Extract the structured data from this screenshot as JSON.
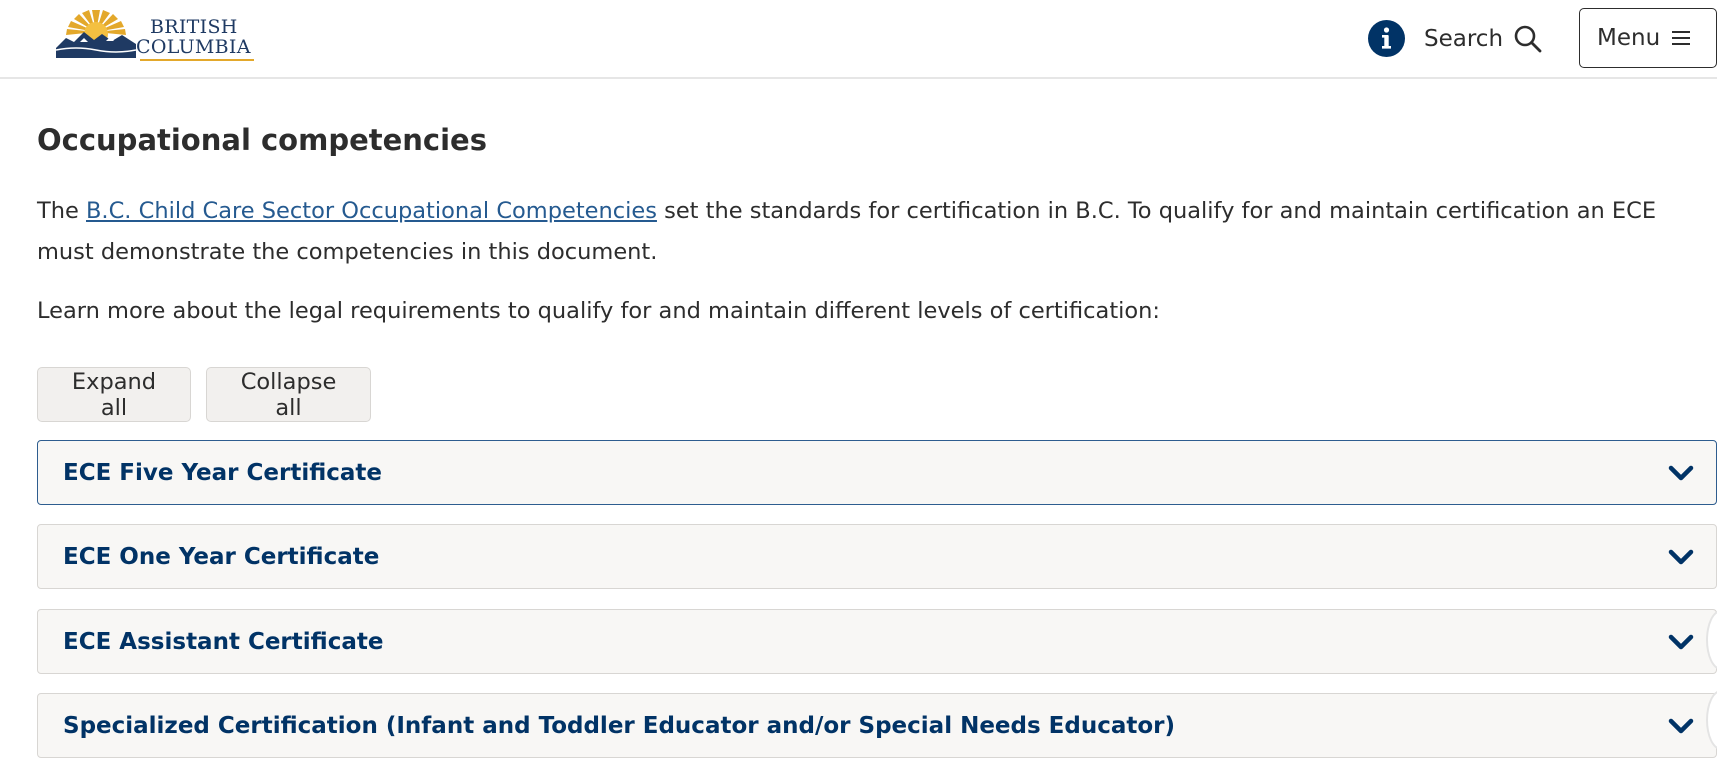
{
  "header": {
    "logo": {
      "line1": "BRITISH",
      "line2": "COLUMBIA",
      "colors": {
        "sun": "#e3a82b",
        "mountains": "#1f3a63"
      }
    },
    "info_icon": "info-icon",
    "search": {
      "label": "Search",
      "icon": "search-icon"
    },
    "menu": {
      "label": "Menu",
      "icon": "hamburger-icon"
    }
  },
  "main": {
    "title": "Occupational competencies",
    "intro": {
      "before_link": "The ",
      "link_text": "B.C. Child Care Sector Occupational Competencies",
      "after_link": " set the standards for certification in B.C. To qualify for and maintain certification an ECE must demonstrate the competencies in this document."
    },
    "learn_more": "Learn more about the legal requirements to qualify for and maintain different levels of certification:",
    "buttons": {
      "expand_all": "Expand all",
      "collapse_all": "Collapse all"
    },
    "accordions": [
      {
        "title": "ECE Five Year Certificate",
        "expanded": false,
        "focused": true
      },
      {
        "title": "ECE One Year Certificate",
        "expanded": false
      },
      {
        "title": "ECE Assistant Certificate",
        "expanded": false
      },
      {
        "title": "Specialized Certification (Infant and Toddler Educator and/or Special Needs Educator)",
        "expanded": false
      }
    ]
  },
  "colors": {
    "brand_blue": "#013366",
    "link": "#255a90",
    "gold": "#e3a82b",
    "text": "#2d2d2d"
  }
}
